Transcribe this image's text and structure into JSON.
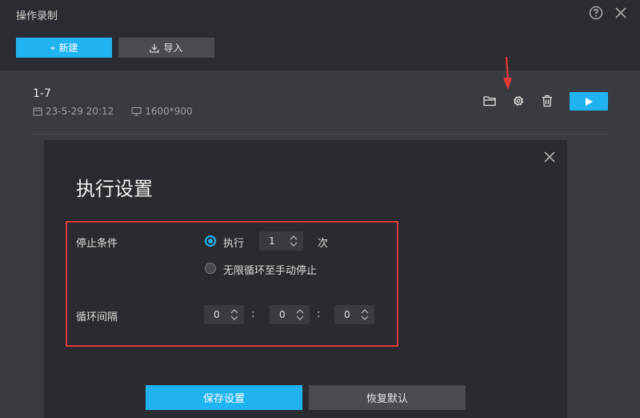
{
  "window": {
    "title": "操作录制"
  },
  "toolbar": {
    "new_label": "新建",
    "import_label": "导入"
  },
  "recording": {
    "name": "1-7",
    "date": "23-5-29  20:12",
    "resolution": "1600*900"
  },
  "dialog": {
    "title": "执行设置",
    "stop_condition_label": "停止条件",
    "execute_label": "执行",
    "execute_count": "1",
    "times_unit": "次",
    "infinite_label": "无限循环至手动停止",
    "interval_label": "循环间隔",
    "interval_h": "0",
    "interval_m": "0",
    "interval_s": "0",
    "colon": ":",
    "save_label": "保存设置",
    "restore_label": "恢复默认"
  },
  "colors": {
    "accent": "#1fb3f1",
    "highlight": "#e03a3a"
  }
}
